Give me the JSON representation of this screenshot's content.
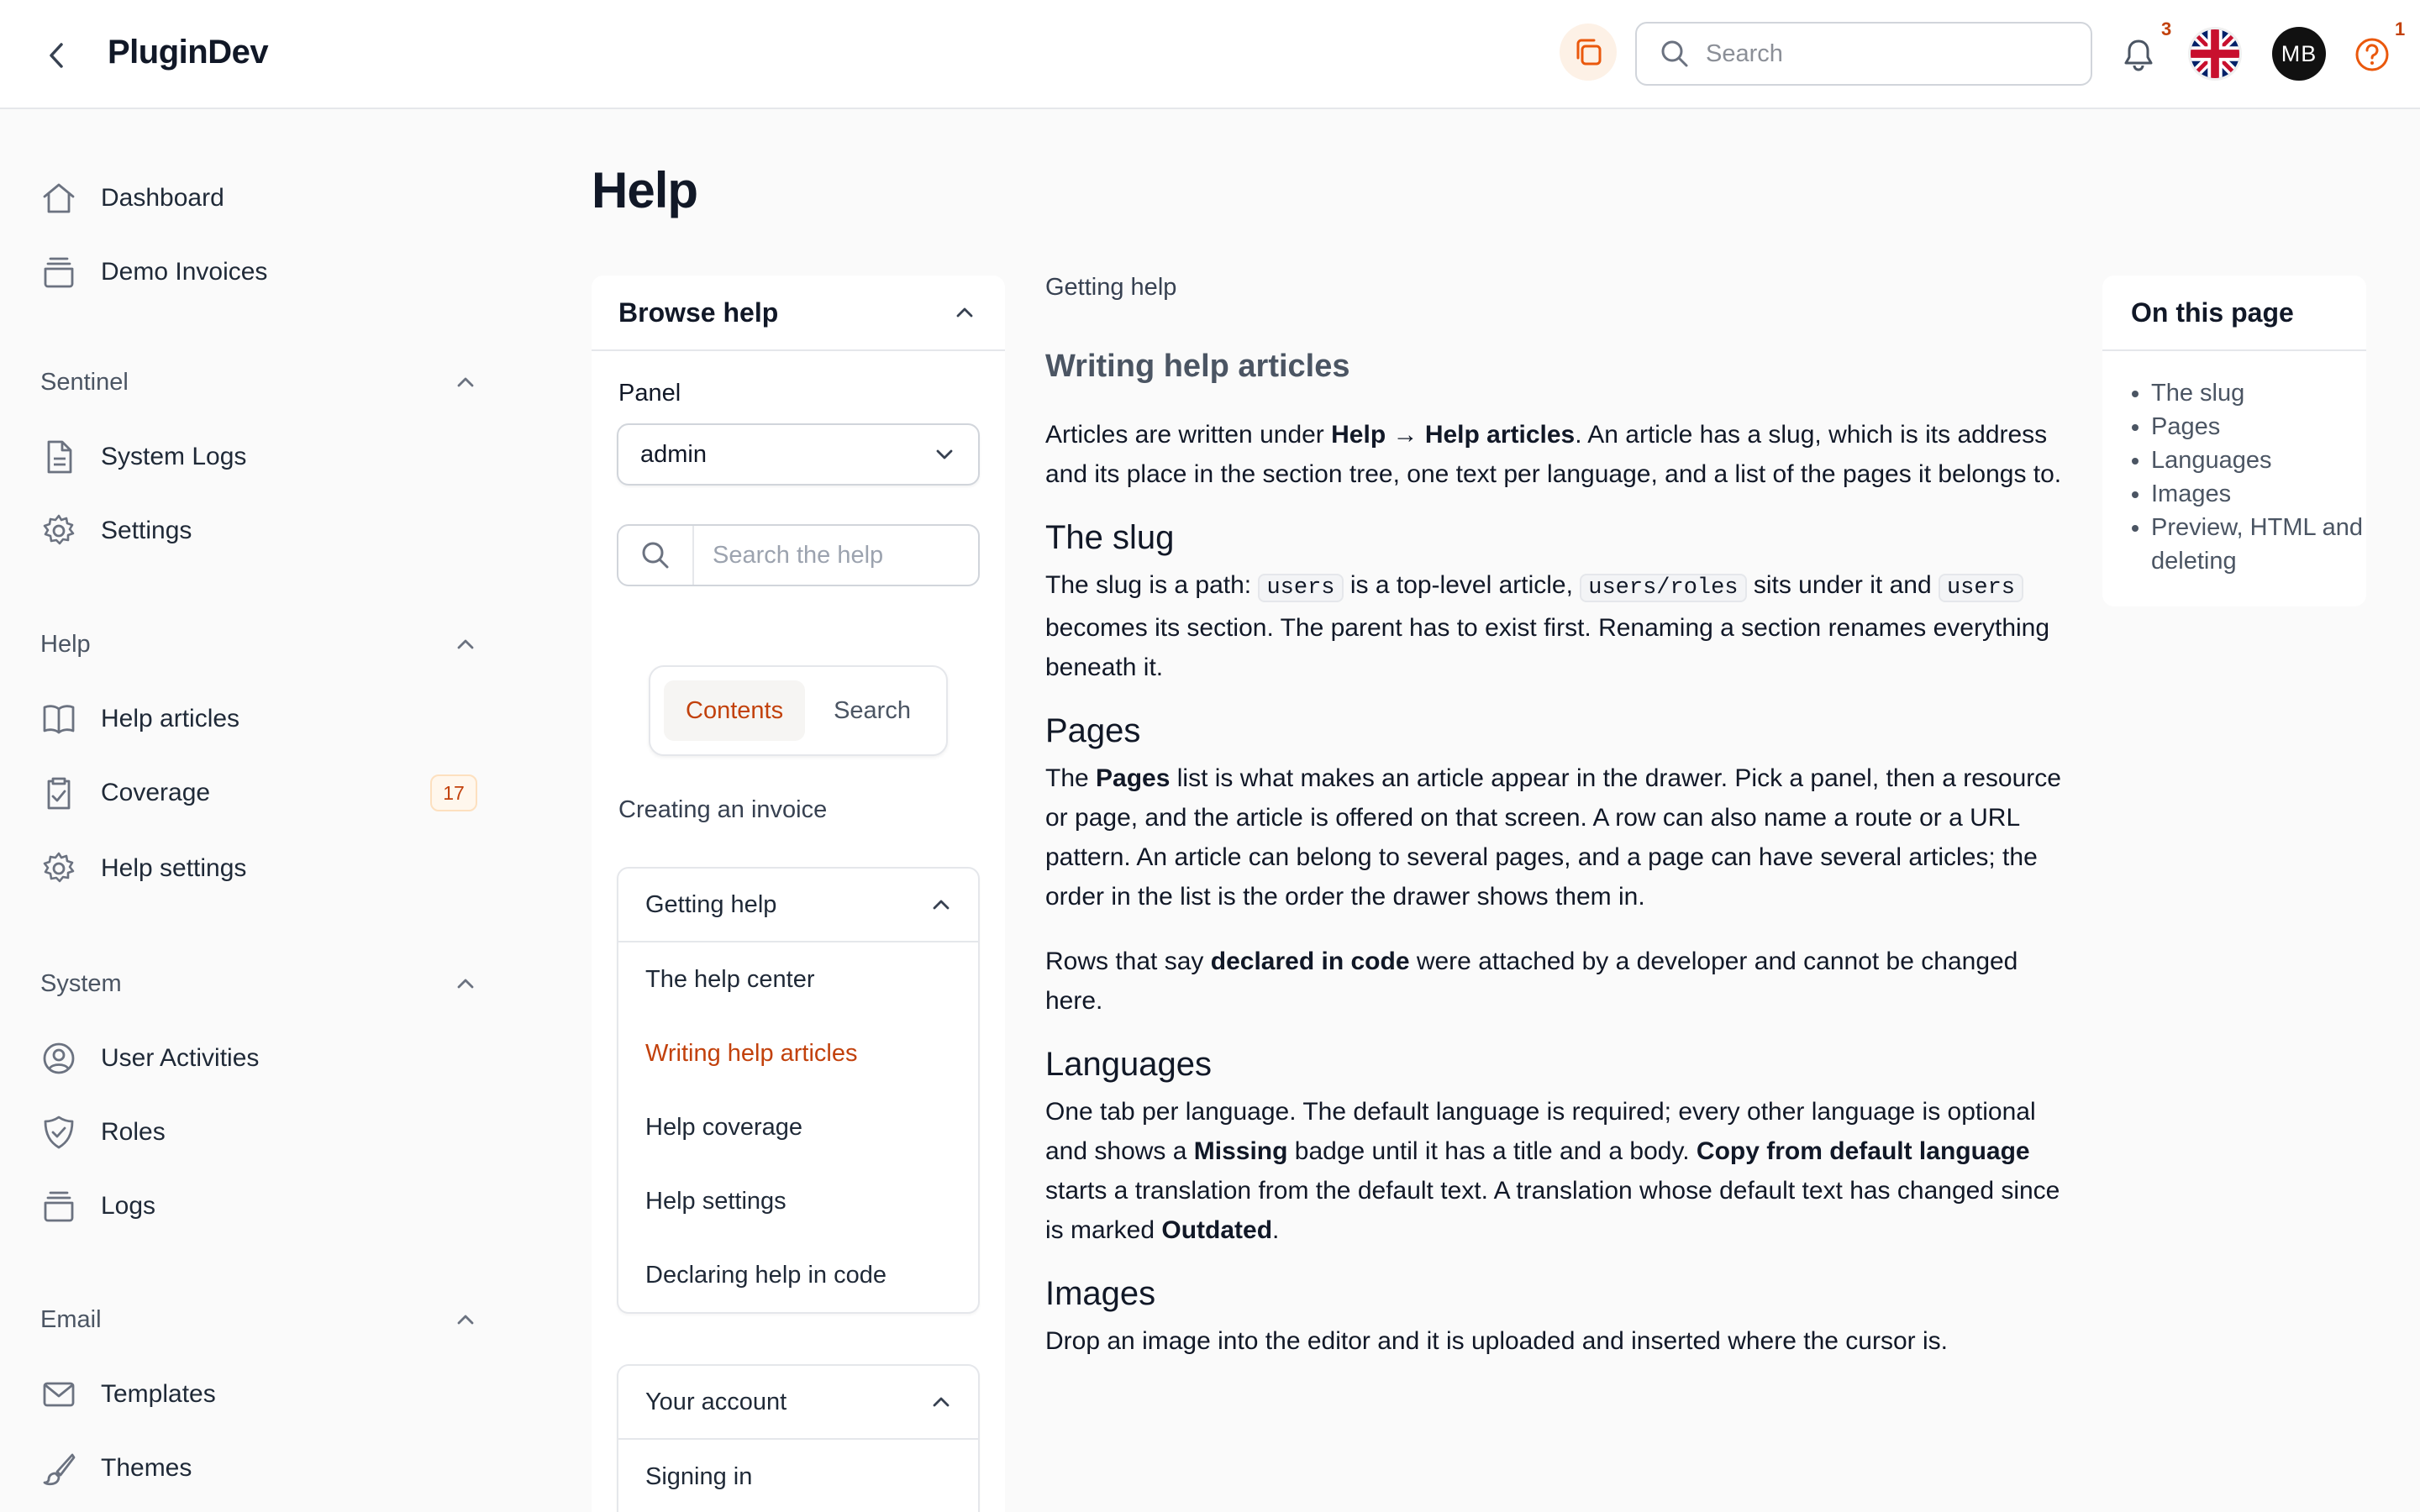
{
  "header": {
    "brand": "PluginDev",
    "search_placeholder": "Search",
    "notifications_count": "3",
    "help_count": "1",
    "avatar_initials": "MB"
  },
  "sidebar": {
    "top_items": [
      {
        "label": "Dashboard",
        "icon": "home-icon"
      },
      {
        "label": "Demo Invoices",
        "icon": "archive-icon"
      }
    ],
    "groups": [
      {
        "label": "Sentinel",
        "items": [
          {
            "label": "System Logs",
            "icon": "document-icon"
          },
          {
            "label": "Settings",
            "icon": "gear-icon"
          }
        ]
      },
      {
        "label": "Help",
        "items": [
          {
            "label": "Help articles",
            "icon": "book-icon"
          },
          {
            "label": "Coverage",
            "icon": "clipboard-check-icon",
            "badge": "17"
          },
          {
            "label": "Help settings",
            "icon": "gear-icon"
          }
        ]
      },
      {
        "label": "System",
        "items": [
          {
            "label": "User Activities",
            "icon": "user-circle-icon"
          },
          {
            "label": "Roles",
            "icon": "shield-check-icon"
          },
          {
            "label": "Logs",
            "icon": "archive-icon"
          }
        ]
      },
      {
        "label": "Email",
        "items": [
          {
            "label": "Templates",
            "icon": "envelope-icon"
          },
          {
            "label": "Themes",
            "icon": "paintbrush-icon"
          }
        ]
      }
    ]
  },
  "main": {
    "title": "Help",
    "browse": {
      "title": "Browse help",
      "panel_label": "Panel",
      "panel_value": "admin",
      "search_placeholder": "Search the help",
      "tabs": [
        "Contents",
        "Search"
      ],
      "active_tab": "Contents",
      "standalone_item": "Creating an invoice",
      "sections": [
        {
          "title": "Getting help",
          "items": [
            "The help center",
            "Writing help articles",
            "Help coverage",
            "Help settings",
            "Declaring help in code"
          ],
          "active": "Writing help articles"
        },
        {
          "title": "Your account",
          "items": [
            "Signing in"
          ]
        }
      ]
    },
    "article": {
      "breadcrumb": "Getting help",
      "title": "Writing help articles",
      "intro": {
        "t1": "Articles are written under ",
        "b1": "Help → Help articles",
        "t2": ". An article has a slug, which is its address and its place in the section tree, one text per language, and a list of the pages it belongs to."
      },
      "slug": {
        "heading": "The slug",
        "t1": "The slug is a path: ",
        "c1": "users",
        "t2": " is a top-level article, ",
        "c2": "users/roles",
        "t3": " sits under it and ",
        "c3": "users",
        "t4": " becomes its section. The parent has to exist first. Renaming a section renames everything beneath it."
      },
      "pages": {
        "heading": "Pages",
        "t1": "The ",
        "b1": "Pages",
        "t2": " list is what makes an article appear in the drawer. Pick a panel, then a resource or page, and the article is offered on that screen. A row can also name a route or a URL pattern. An article can belong to several pages, and a page can have several articles; the order in the list is the order the drawer shows them in.",
        "p2_t1": "Rows that say ",
        "p2_b1": "declared in code",
        "p2_t2": " were attached by a developer and cannot be changed here."
      },
      "languages": {
        "heading": "Languages",
        "t1": "One tab per language. The default language is required; every other language is optional and shows a ",
        "b1": "Missing",
        "t2": " badge until it has a title and a body. ",
        "b2": "Copy from default language",
        "t3": " starts a translation from the default text. A translation whose default text has changed since is marked ",
        "b3": "Outdated",
        "t4": "."
      },
      "images": {
        "heading": "Images",
        "t1": "Drop an image into the editor and it is uploaded and inserted where the cursor is."
      }
    },
    "toc": {
      "title": "On this page",
      "items": [
        "The slug",
        "Pages",
        "Languages",
        "Images",
        "Preview, HTML and deleting"
      ]
    }
  },
  "colors": {
    "accent": "#c2410c",
    "border": "#e5e7eb",
    "background": "#fafafa"
  }
}
